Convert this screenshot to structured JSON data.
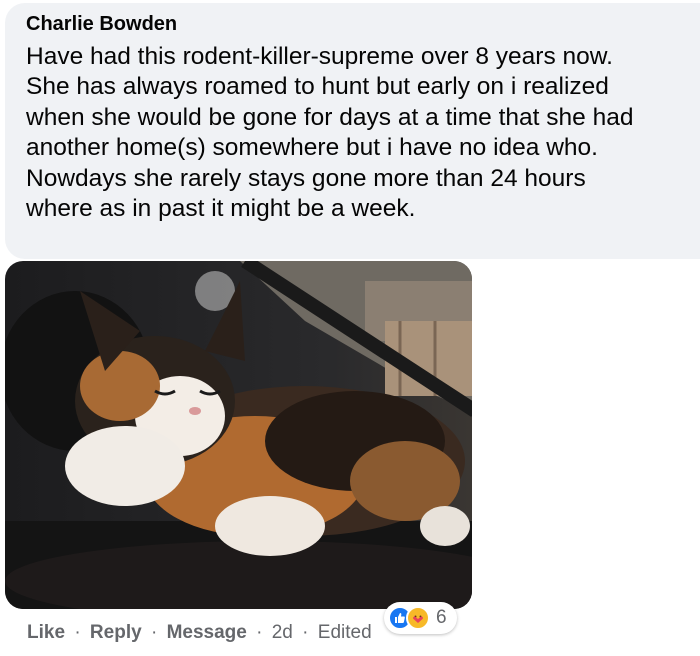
{
  "comment": {
    "author": "Charlie Bowden",
    "text": "Have had this rodent-killer-supreme over 8 years now.\nShe has always roamed to hunt but early on i realized\nwhen she would be gone for days at a time that she had\nanother home(s) somewhere but i have no idea who.\nNowdays she rarely stays gone more than 24 hours\nwhere as in past it might be a week."
  },
  "actions": {
    "like": "Like",
    "reply": "Reply",
    "message": "Message",
    "time": "2d",
    "edited": "Edited",
    "separator": "·"
  },
  "reactions": {
    "count": "6",
    "icons": [
      "like-icon",
      "care-icon"
    ],
    "like_color": "#1877f2",
    "care_color": "#f7b928"
  },
  "photo": {
    "subject": "calico-cat-photo"
  }
}
